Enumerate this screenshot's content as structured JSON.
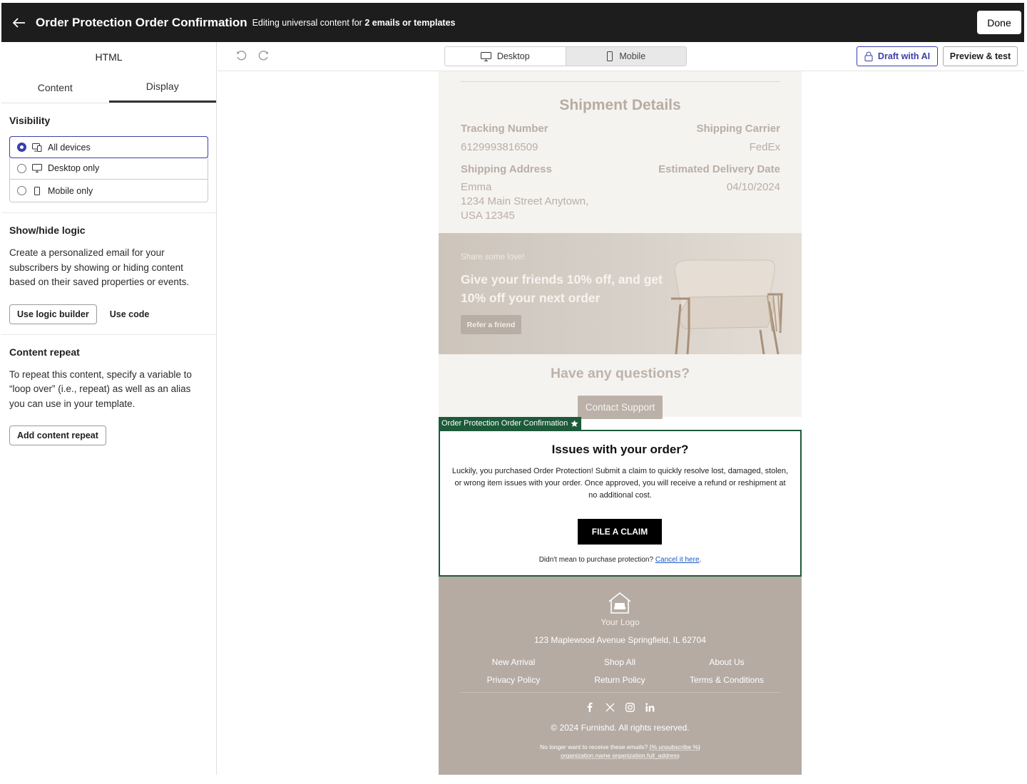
{
  "header": {
    "title": "Order Protection Order Confirmation",
    "subtitle_prefix": "Editing universal content for",
    "subtitle_bold": "2 emails or templates",
    "done_label": "Done"
  },
  "sidebar": {
    "heading": "HTML",
    "tabs": [
      {
        "label": "Content"
      },
      {
        "label": "Display"
      }
    ],
    "visibility": {
      "title": "Visibility",
      "options": [
        {
          "label": "All devices",
          "selected": true
        },
        {
          "label": "Desktop only",
          "selected": false
        },
        {
          "label": "Mobile only",
          "selected": false
        }
      ]
    },
    "logic": {
      "title": "Show/hide logic",
      "description": "Create a personalized email for your subscribers by showing or hiding content based on their saved properties or events.",
      "builder_label": "Use logic builder",
      "code_label": "Use code"
    },
    "repeat": {
      "title": "Content repeat",
      "description": "To repeat this content, specify a variable to “loop over” (i.e., repeat) as well as an alias you can use in your template.",
      "button_label": "Add content repeat"
    }
  },
  "toolbar": {
    "desktop_label": "Desktop",
    "mobile_label": "Mobile",
    "active_view": "Desktop",
    "draft_label": "Draft with AI",
    "preview_label": "Preview & test"
  },
  "email": {
    "shipment": {
      "title": "Shipment Details",
      "tracking_label": "Tracking Number",
      "tracking_value": "6129993816509",
      "carrier_label": "Shipping Carrier",
      "carrier_value": "FedEx",
      "address_label": "Shipping Address",
      "address_name": "Emma",
      "address_line1": "1234 Main Street Anytown,",
      "address_line2": "USA 12345",
      "delivery_label": "Estimated Delivery Date",
      "delivery_value": "04/10/2024"
    },
    "banner": {
      "eyebrow": "Share some love!",
      "headline": "Give your friends 10% off, and get 10% off your next order",
      "button_label": "Refer a friend"
    },
    "questions": {
      "title": "Have any questions?",
      "button_label": "Contact Support"
    },
    "block_tag": "Order Protection Order Confirmation",
    "order_protection": {
      "title": "Issues with your order?",
      "body": "Luckily, you purchased Order Protection! Submit a claim to quickly resolve lost, damaged, stolen, or wrong item issues with your order. Once approved, you will receive a refund or reshipment at no additional cost.",
      "claim_label": "FILE A CLAIM",
      "cancel_prefix": "Didn't mean to purchase protection?",
      "cancel_link": "Cancel it here",
      "cancel_suffix": "."
    },
    "footer": {
      "logo_text": "Your Logo",
      "address": "123 Maplewood Avenue Springfield, IL 62704",
      "links": [
        "New Arrival",
        "Shop All",
        "About Us",
        "Privacy Policy",
        "Return Policy",
        "Terms & Conditions"
      ],
      "copyright": "© 2024 Furnishd. All rights reserved.",
      "unsub_prefix": "No longer want to receive these emails?",
      "unsub_tag": "{% unsubscribe %}",
      "unsub_line2": "organization.name organization.full_address"
    },
    "colors": {
      "block_border": "#1d5a3a",
      "accent": "#3a3fa8",
      "footer_bg": "#b5aba3"
    }
  }
}
